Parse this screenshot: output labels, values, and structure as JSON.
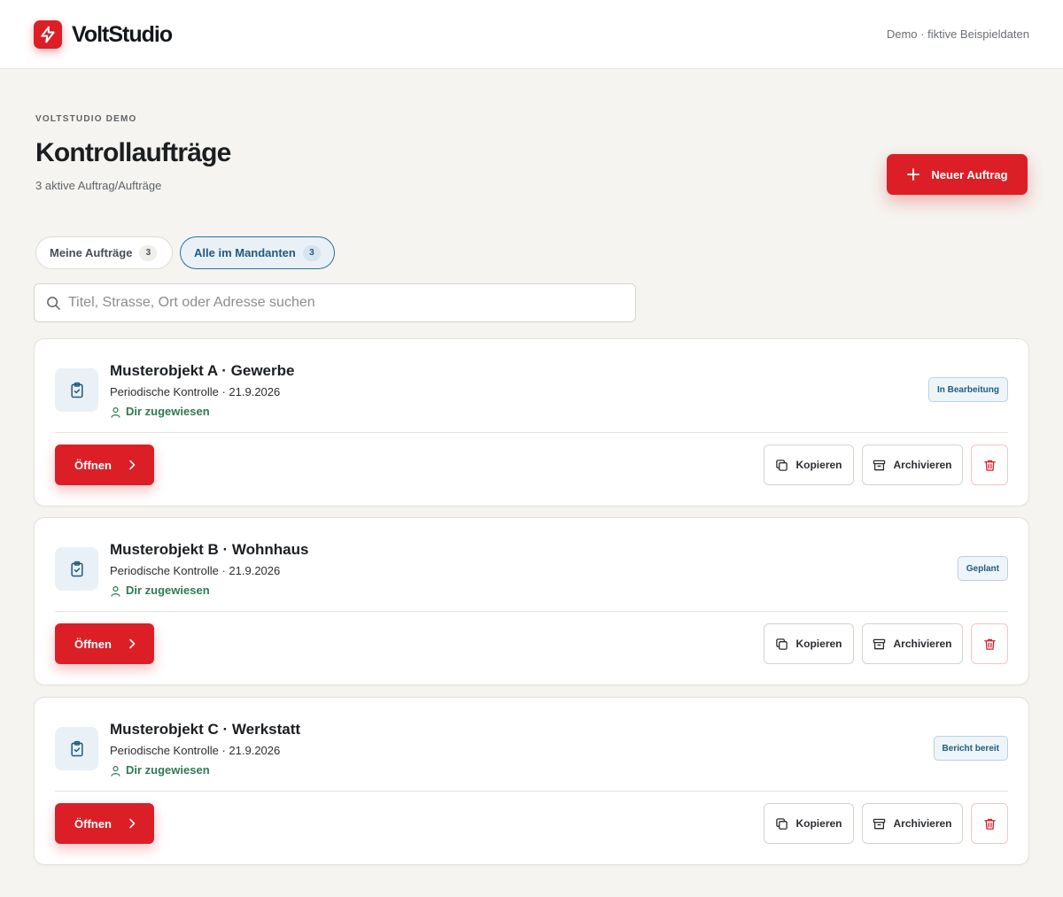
{
  "header": {
    "brand": "VoltStudio",
    "demo_note": "Demo · fiktive Beispieldaten"
  },
  "page": {
    "eyebrow": "VOLTSTUDIO DEMO",
    "title": "Kontrollaufträge",
    "subtitle": "3 aktive Auftrag/Aufträge",
    "new_button": "Neuer Auftrag"
  },
  "tabs": [
    {
      "label": "Meine Aufträge",
      "count": "3",
      "active": false
    },
    {
      "label": "Alle im Mandanten",
      "count": "3",
      "active": true
    }
  ],
  "search": {
    "placeholder": "Titel, Strasse, Ort oder Adresse suchen",
    "value": ""
  },
  "cards": [
    {
      "title": "Musterobjekt A · Gewerbe",
      "meta": "Periodische Kontrolle · 21.9.2026",
      "assigned": "Dir zugewiesen",
      "status": "In Bearbeitung",
      "open_label": "Öffnen",
      "copy_label": "Kopieren",
      "archive_label": "Archivieren"
    },
    {
      "title": "Musterobjekt B · Wohnhaus",
      "meta": "Periodische Kontrolle · 21.9.2026",
      "assigned": "Dir zugewiesen",
      "status": "Geplant",
      "open_label": "Öffnen",
      "copy_label": "Kopieren",
      "archive_label": "Archivieren"
    },
    {
      "title": "Musterobjekt C · Werkstatt",
      "meta": "Periodische Kontrolle · 21.9.2026",
      "assigned": "Dir zugewiesen",
      "status": "Bericht bereit",
      "open_label": "Öffnen",
      "copy_label": "Kopieren",
      "archive_label": "Archivieren"
    }
  ],
  "colors": {
    "accent": "#dc1f26",
    "info": "#1f5a80",
    "success": "#2f7a52",
    "background": "#f5f4f0"
  },
  "icons": [
    "bolt-icon",
    "plus-icon",
    "search-icon",
    "clipboard-check-icon",
    "user-icon",
    "chevron-right-icon",
    "copy-icon",
    "archive-icon",
    "trash-icon"
  ]
}
